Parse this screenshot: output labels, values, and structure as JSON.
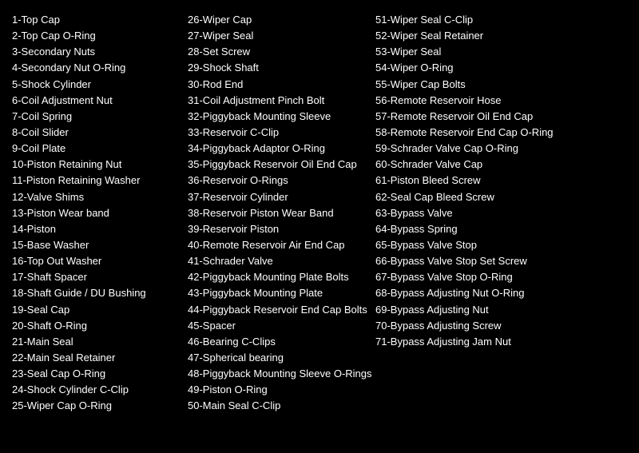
{
  "col1": {
    "items": [
      "1-Top Cap",
      "2-Top Cap O-Ring",
      "3-Secondary Nuts",
      "4-Secondary Nut O-Ring",
      "5-Shock Cylinder",
      "6-Coil Adjustment Nut",
      "7-Coil Spring",
      "8-Coil Slider",
      "9-Coil Plate",
      "10-Piston Retaining Nut",
      "11-Piston Retaining Washer",
      "12-Valve Shims",
      "13-Piston Wear band",
      "14-Piston",
      "15-Base Washer",
      "16-Top Out Washer",
      "17-Shaft Spacer",
      "18-Shaft Guide / DU Bushing",
      "19-Seal Cap",
      "20-Shaft O-Ring",
      "21-Main Seal",
      "22-Main Seal Retainer",
      "23-Seal Cap O-Ring",
      "24-Shock Cylinder C-Clip",
      "25-Wiper Cap O-Ring"
    ]
  },
  "col2": {
    "items": [
      "26-Wiper Cap",
      "27-Wiper Seal",
      "28-Set Screw",
      "29-Shock Shaft",
      "30-Rod End",
      "31-Coil Adjustment Pinch Bolt",
      "32-Piggyback Mounting Sleeve",
      "33-Reservoir C-Clip",
      "34-Piggyback Adaptor O-Ring",
      "35-Piggyback Reservoir Oil End Cap",
      "36-Reservoir O-Rings",
      "37-Reservoir Cylinder",
      "38-Reservoir Piston Wear Band",
      "39-Reservoir Piston",
      "40-Remote Reservoir Air End Cap",
      "41-Schrader Valve",
      "42-Piggyback Mounting Plate Bolts",
      "43-Piggyback Mounting Plate",
      "44-Piggyback Reservoir End Cap Bolts",
      "45-Spacer",
      "46-Bearing C-Clips",
      "47-Spherical bearing",
      "48-Piggyback Mounting Sleeve O-Rings",
      "49-Piston O-Ring",
      "50-Main Seal C-Clip"
    ]
  },
  "col3": {
    "items": [
      "51-Wiper Seal C-Clip",
      "52-Wiper Seal Retainer",
      "53-Wiper Seal",
      "54-Wiper O-Ring",
      "55-Wiper Cap Bolts",
      "56-Remote Reservoir Hose",
      "57-Remote Reservoir Oil End Cap",
      "58-Remote Reservoir End Cap O-Ring",
      "59-Schrader Valve Cap O-Ring",
      "60-Schrader Valve Cap",
      "61-Piston Bleed Screw",
      "62-Seal Cap Bleed Screw",
      "63-Bypass Valve",
      "64-Bypass Spring",
      "65-Bypass Valve Stop",
      "66-Bypass Valve Stop Set Screw",
      "67-Bypass Valve Stop O-Ring",
      "68-Bypass Adjusting Nut O-Ring",
      "69-Bypass Adjusting Nut",
      "70-Bypass Adjusting Screw",
      "71-Bypass Adjusting Jam Nut"
    ]
  }
}
